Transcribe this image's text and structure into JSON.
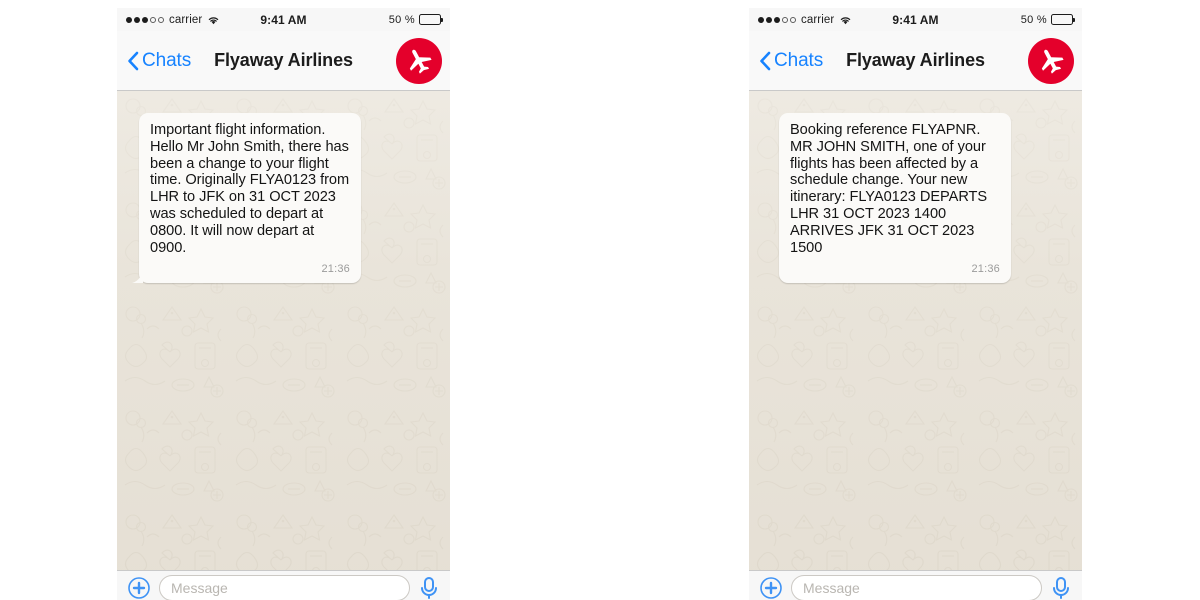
{
  "phones": [
    {
      "id": "phone-left",
      "status_bar": {
        "signal_dots_filled": 3,
        "signal_dots_empty": 2,
        "carrier": "carrier",
        "wifi_icon": "wifi-icon",
        "time": "9:41 AM",
        "battery_percent_label": "50 %",
        "battery_level": 50
      },
      "nav_bar": {
        "back_icon": "chevron-left-icon",
        "back_label": "Chats",
        "title": "Flyaway Airlines",
        "avatar_icon": "airplane-icon",
        "avatar_color": "#e4002b"
      },
      "message": {
        "text": "Important flight information. Hello Mr John Smith, there has been a change to your flight time. Originally FLYA0123 from LHR to JFK on 31 OCT 2023 was scheduled to depart at 0800. It will now depart at 0900.",
        "time": "21:36",
        "has_tail": true
      },
      "input_bar": {
        "attach_icon": "plus-circle-icon",
        "placeholder": "Message",
        "value": "",
        "mic_icon": "microphone-icon"
      }
    },
    {
      "id": "phone-right",
      "status_bar": {
        "signal_dots_filled": 3,
        "signal_dots_empty": 2,
        "carrier": "carrier",
        "wifi_icon": "wifi-icon",
        "time": "9:41 AM",
        "battery_percent_label": "50 %",
        "battery_level": 50
      },
      "nav_bar": {
        "back_icon": "chevron-left-icon",
        "back_label": "Chats",
        "title": "Flyaway Airlines",
        "avatar_icon": "airplane-icon",
        "avatar_color": "#e4002b"
      },
      "message": {
        "text": "Booking reference FLYAPNR. MR JOHN SMITH, one of your flights has been affected by a schedule change. Your new itinerary: FLYA0123 DEPARTS LHR 31 OCT 2023 1400 ARRIVES JFK 31 OCT 2023 1500",
        "time": "21:36",
        "has_tail": false
      },
      "input_bar": {
        "attach_icon": "plus-circle-icon",
        "placeholder": "Message",
        "value": "",
        "mic_icon": "microphone-icon"
      }
    }
  ],
  "colors": {
    "accent_blue": "#1783ff",
    "brand_red": "#e4002b",
    "bubble_bg": "#fbfaf8",
    "chat_bg": "#ded7ca",
    "bar_bg": "#f7f7f7"
  }
}
